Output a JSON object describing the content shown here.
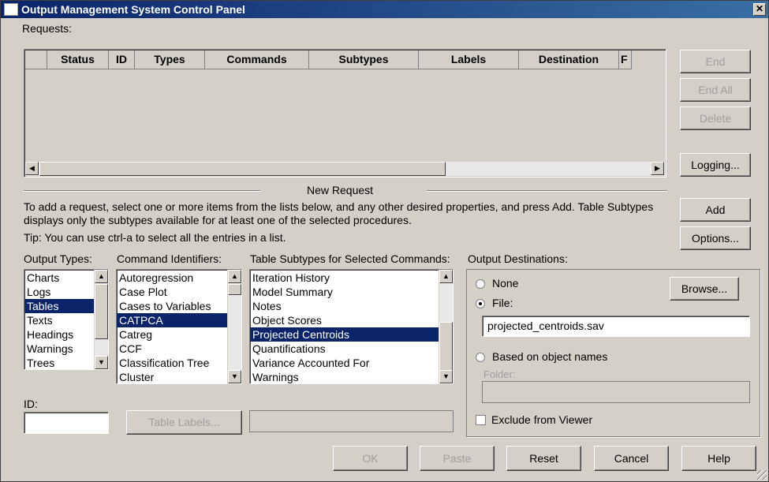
{
  "window": {
    "title": "Output Management System Control Panel",
    "close": "✕"
  },
  "requests": {
    "label": "Requests:",
    "columns": [
      "",
      "Status",
      "ID",
      "Types",
      "Commands",
      "Subtypes",
      "Labels",
      "Destination",
      "F"
    ]
  },
  "side_buttons": {
    "end": "End",
    "end_all": "End All",
    "delete": "Delete",
    "logging": "Logging...",
    "add": "Add",
    "options": "Options..."
  },
  "new_request": {
    "heading": "New Request",
    "instructions": "To add a request, select one or more items from the lists below, and any other desired properties, and press Add. Table Subtypes displays only the subtypes available for at least one of the selected procedures.",
    "tip": "Tip: You can use ctrl-a to select all the entries in a list."
  },
  "output_types": {
    "label": "Output Types:",
    "items": [
      "Charts",
      "Logs",
      "Tables",
      "Texts",
      "Headings",
      "Warnings",
      "Trees"
    ],
    "selected": "Tables"
  },
  "command_identifiers": {
    "label": "Command Identifiers:",
    "items": [
      "Autoregression",
      "Case Plot",
      "Cases to Variables",
      "CATPCA",
      "Catreg",
      "CCF",
      "Classification Tree",
      "Cluster"
    ],
    "selected": "CATPCA"
  },
  "table_subtypes": {
    "label": "Table Subtypes for Selected Commands:",
    "items": [
      "Iteration History",
      "Model Summary",
      "Notes",
      "Object Scores",
      "Projected Centroids",
      "Quantifications",
      "Variance Accounted For",
      "Warnings"
    ],
    "selected": "Projected Centroids"
  },
  "output_destinations": {
    "label": "Output Destinations:",
    "none": "None",
    "file": "File:",
    "file_value": "projected_centroids.sav",
    "browse": "Browse...",
    "based_on_object_names": "Based on object names",
    "folder": "Folder:",
    "folder_value": "",
    "exclude_from_viewer": "Exclude from Viewer",
    "selected": "File"
  },
  "id": {
    "label": "ID:",
    "value": ""
  },
  "table_labels": {
    "button": "Table Labels...",
    "value": ""
  },
  "footer": {
    "ok": "OK",
    "paste": "Paste",
    "reset": "Reset",
    "cancel": "Cancel",
    "help": "Help"
  }
}
